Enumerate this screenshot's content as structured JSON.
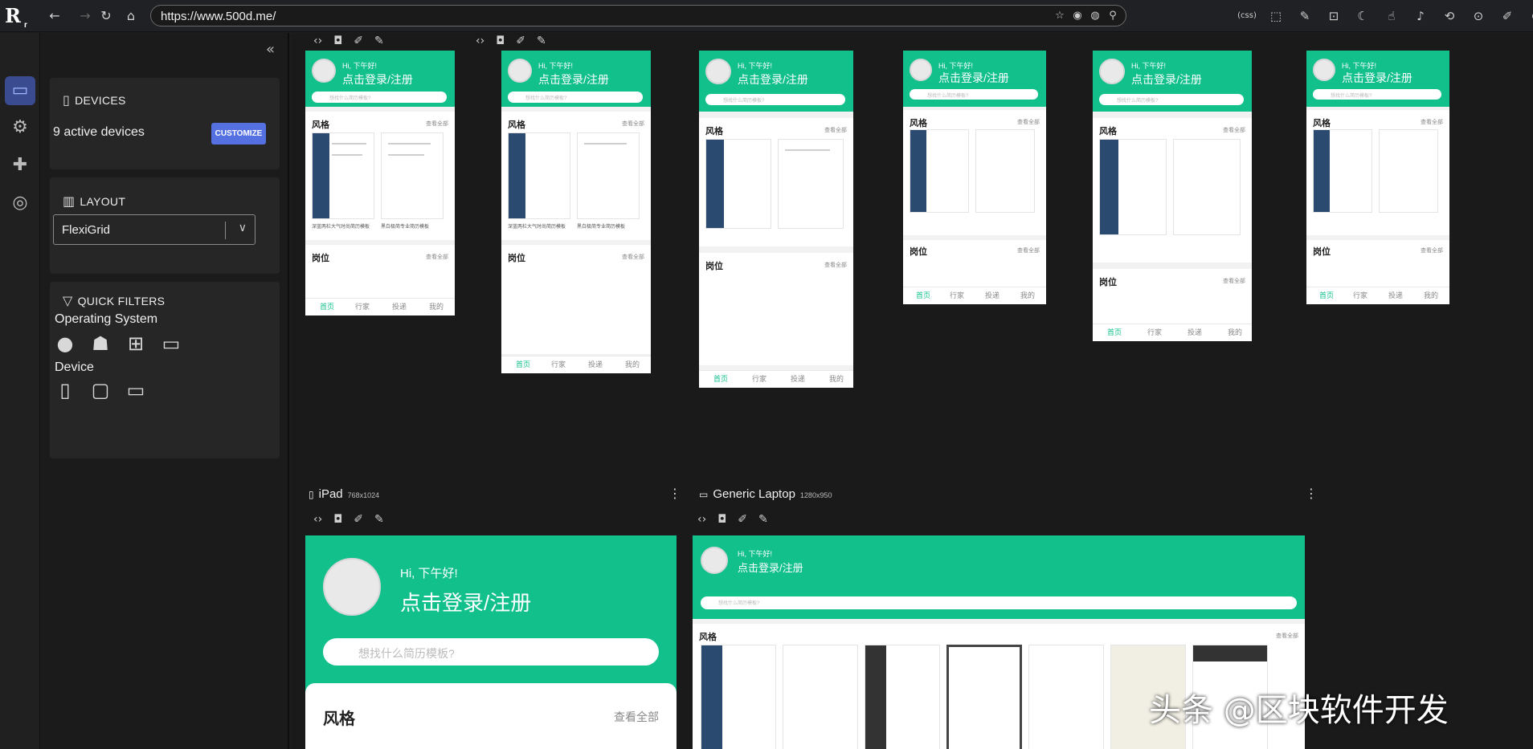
{
  "browser": {
    "url": "https://www.500d.me/",
    "logo": "R",
    "logo_sub": "r"
  },
  "sidebar_rail": [
    "devices-icon",
    "gear-icon",
    "puzzle-icon",
    "globe-icon"
  ],
  "devices_card": {
    "heading": "DEVICES",
    "count": "9 active devices",
    "customize": "CUSTOMIZE"
  },
  "layout_card": {
    "heading": "LAYOUT",
    "value": "FlexiGrid"
  },
  "filters_card": {
    "heading": "QUICK FILTERS",
    "os_label": "Operating System",
    "device_label": "Device"
  },
  "devices": {
    "ipad": {
      "name": "iPad",
      "size": "768x1024"
    },
    "laptop": {
      "name": "Generic Laptop",
      "size": "1280x950"
    }
  },
  "site": {
    "greeting": "Hi, 下午好!",
    "login": "点击登录/注册",
    "search_placeholder": "想找什么简历模板?",
    "style_title": "风格",
    "style_more": "查看全部",
    "job_title": "岗位",
    "job_more": "查看全部",
    "tabs": [
      "首页",
      "行家",
      "投递",
      "我的"
    ],
    "caption_1": "深蓝两栏大气时尚简历模板",
    "caption_2": "黑白极简专业简历模板"
  },
  "watermark": "头条 @区块软件开发",
  "colors": {
    "brand_green": "#12c08c",
    "accent_blue": "#5570e0"
  }
}
